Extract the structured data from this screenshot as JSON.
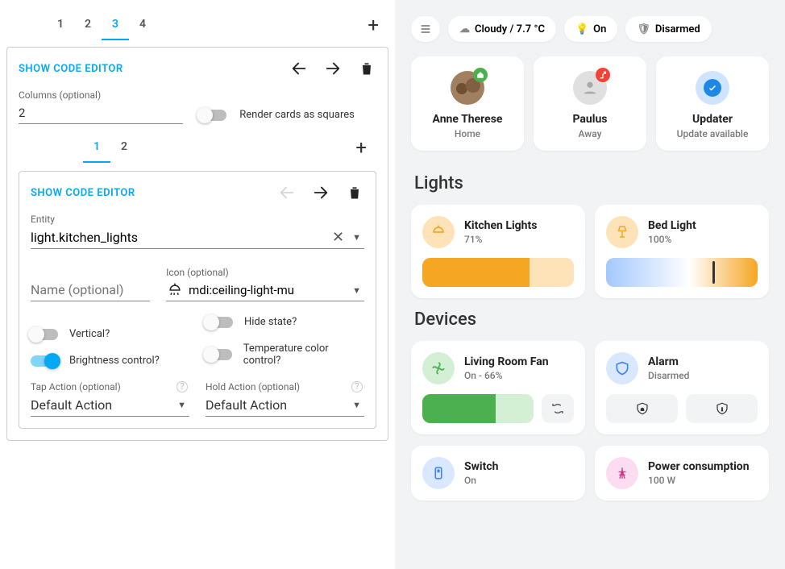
{
  "editor": {
    "outer_tabs": [
      "1",
      "2",
      "3",
      "4"
    ],
    "outer_active": 2,
    "show_code_label": "SHOW CODE EDITOR",
    "columns_label": "Columns (optional)",
    "columns_value": "2",
    "render_squares_label": "Render cards as squares",
    "inner_tabs": [
      "1",
      "2"
    ],
    "inner_active": 0,
    "entity_label": "Entity",
    "entity_value": "light.kitchen_lights",
    "name_label": "Name (optional)",
    "name_value": "",
    "icon_label": "Icon (optional)",
    "icon_value": "mdi:ceiling-light-mu",
    "vertical_label": "Vertical?",
    "hide_state_label": "Hide state?",
    "brightness_label": "Brightness control?",
    "color_temp_label": "Temperature color control?",
    "tap_action_label": "Tap Action (optional)",
    "tap_action_value": "Default Action",
    "hold_action_label": "Hold Action (optional)",
    "hold_action_value": "Default Action"
  },
  "dashboard": {
    "weather": "Cloudy / 7.7 °C",
    "light_state": "On",
    "alarm_state": "Disarmed",
    "persons": [
      {
        "name": "Anne Therese",
        "state": "Home",
        "badge": "home"
      },
      {
        "name": "Paulus",
        "state": "Away",
        "badge": "away"
      },
      {
        "name": "Updater",
        "state": "Update available",
        "badge": "check"
      }
    ],
    "lights_header": "Lights",
    "lights": [
      {
        "title": "Kitchen Lights",
        "sub": "71%",
        "pct": 71
      },
      {
        "title": "Bed Light",
        "sub": "100%",
        "pct": 100
      }
    ],
    "devices_header": "Devices",
    "fan": {
      "title": "Living Room Fan",
      "sub": "On - 66%",
      "pct": 66
    },
    "alarm": {
      "title": "Alarm",
      "sub": "Disarmed"
    },
    "switch": {
      "title": "Switch",
      "sub": "On"
    },
    "power": {
      "title": "Power consumption",
      "sub": "100 W"
    }
  }
}
